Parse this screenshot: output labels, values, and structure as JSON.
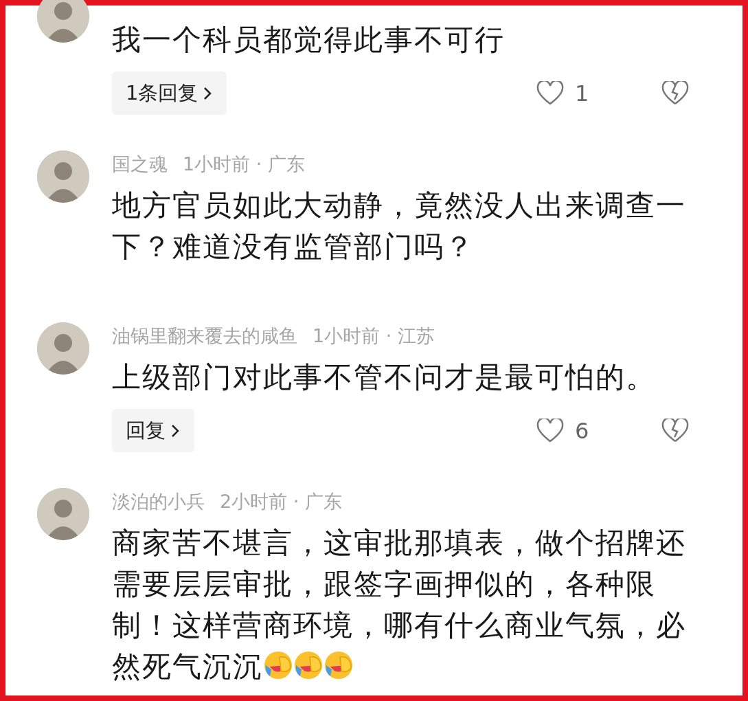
{
  "comments": [
    {
      "text": "我一个科员都觉得此事不可行",
      "reply_label": "1条回复",
      "likes": "1"
    },
    {
      "name": "国之魂",
      "info": "1小时前 · 广东",
      "text": "地方官员如此大动静，竟然没人出来调查一下？难道没有监管部门吗？"
    },
    {
      "name": "油锅里翻来覆去的咸鱼",
      "info": "1小时前 · 江苏",
      "text": "上级部门对此事不管不问才是最可怕的。",
      "reply_label": "回复",
      "likes": "6"
    },
    {
      "name": "淡泊的小兵",
      "info": "2小时前 · 广东",
      "text": "商家苦不堪言，这审批那填表，做个招牌还需要层层审批，跟签字画押似的，各种限制！这样营商环境，哪有什么商业气氛，必然死气沉沉",
      "emojis": [
        {
          "kind": "laugh-cry"
        },
        {
          "kind": "laugh-cry"
        },
        {
          "kind": "laugh-cry"
        }
      ]
    }
  ]
}
